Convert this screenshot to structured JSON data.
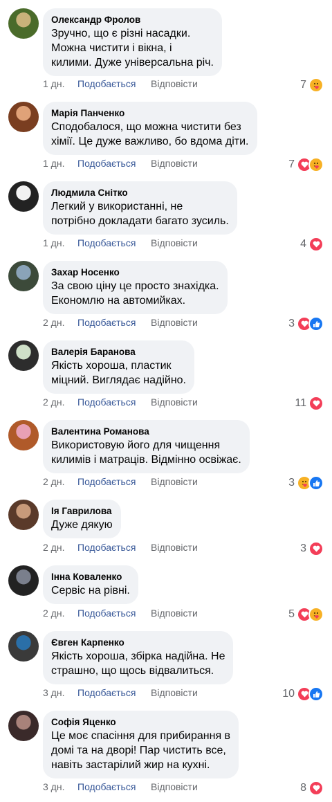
{
  "comments": [
    {
      "author": "Олександр Фролов",
      "text": "Зручно, що є різні насадки.\nМожна чистити і вікна, і\nкилими. Дуже універсальна річ.",
      "time": "1 дн.",
      "like": "Подобається",
      "reply": "Відповісти",
      "reaction_count": "7",
      "reactions": [
        "care-icon"
      ]
    },
    {
      "author": "Марія Панченко",
      "text": "Сподобалося, що можна чистити без\nхімії. Це дуже важливо, бо вдома діти.",
      "time": "1 дн.",
      "like": "Подобається",
      "reply": "Відповісти",
      "reaction_count": "7",
      "reactions": [
        "heart-icon",
        "care-icon"
      ]
    },
    {
      "author": "Людмила Снітко",
      "text": "Легкий у використанні, не\nпотрібно докладати багато зусиль.",
      "time": "1 дн.",
      "like": "Подобається",
      "reply": "Відповісти",
      "reaction_count": "4",
      "reactions": [
        "heart-icon"
      ]
    },
    {
      "author": "Захар Носенко",
      "text": "За свою ціну це просто знахідка.\nЕкономлю на автомийках.",
      "time": "2 дн.",
      "like": "Подобається",
      "reply": "Відповісти",
      "reaction_count": "3",
      "reactions": [
        "heart-icon",
        "like-icon"
      ]
    },
    {
      "author": "Валерія Баранова",
      "text": "Якість хороша, пластик\nміцний. Виглядає надійно.",
      "time": "2 дн.",
      "like": "Подобається",
      "reply": "Відповісти",
      "reaction_count": "11",
      "reactions": [
        "heart-icon"
      ]
    },
    {
      "author": "Валентина Романова",
      "text": "Використовую його для чищення\nкилимів і матраців. Відмінно освіжає.",
      "time": "2 дн.",
      "like": "Подобається",
      "reply": "Відповісти",
      "reaction_count": "3",
      "reactions": [
        "care-icon",
        "like-icon"
      ]
    },
    {
      "author": "Ія Гаврилова",
      "text": "Дуже дякую",
      "time": "2 дн.",
      "like": "Подобається",
      "reply": "Відповісти",
      "reaction_count": "3",
      "reactions": [
        "heart-icon"
      ]
    },
    {
      "author": "Інна Коваленко",
      "text": "Сервіс на рівні.",
      "time": "2 дн.",
      "like": "Подобається",
      "reply": "Відповісти",
      "reaction_count": "5",
      "reactions": [
        "heart-icon",
        "care-icon"
      ]
    },
    {
      "author": "Євген Карпенко",
      "text": "Якість хороша, збірка надійна. Не\nстрашно, що щось відвалиться.",
      "time": "3 дн.",
      "like": "Подобається",
      "reply": "Відповісти",
      "reaction_count": "10",
      "reactions": [
        "heart-icon",
        "like-icon"
      ]
    },
    {
      "author": "Софія Яценко",
      "text": "Це моє спасіння для прибирання в\nдомі та на дворі! Пар чистить все,\nнавіть застарілий жир на кухні.",
      "time": "3 дн.",
      "like": "Подобається",
      "reply": "Відповісти",
      "reaction_count": "8",
      "reactions": [
        "heart-icon"
      ]
    }
  ],
  "colors": {
    "bubble": "#f0f2f5",
    "like_link": "#385898",
    "muted": "#65676b",
    "heart": "#f33e58",
    "care": "#f7b125",
    "like": "#1877f2"
  }
}
